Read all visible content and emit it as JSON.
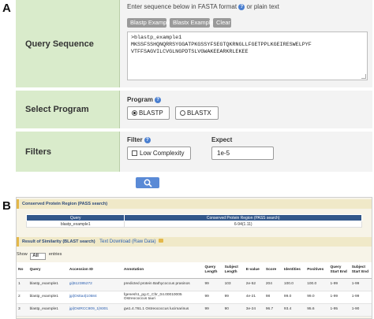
{
  "panel_labels": {
    "a": "A",
    "b": "B"
  },
  "colors": {
    "label_bg": "#d9ebcb",
    "accent_blue": "#5a8ad6",
    "table_header": "#32578a",
    "section_bar": "#e4b84a",
    "button_gray": "#9a9a9a"
  },
  "query": {
    "label": "Query Sequence",
    "hint": "Enter sequence below in FASTA format",
    "hint_suffix": "or plain text",
    "buttons": {
      "blastp_example": "Blastp Example",
      "blastx_example": "Blastx Example",
      "clear": "Clear"
    },
    "sequence_lines": [
      ">blastp_example1",
      "MKSSFSSHQNQRRSYGGATPKGSSYFSEGTQKRNGLLFGETPPLKGEIRESWELPYF",
      "VTFFSAGVILCVGLNGPDTSLVGWAKEEARKRLEKEE"
    ]
  },
  "program": {
    "label": "Select Program",
    "field_label": "Program",
    "options": [
      "BLASTP",
      "BLASTX"
    ],
    "selected": "BLASTP"
  },
  "filters": {
    "label": "Filters",
    "filter_label": "Filter",
    "low_complexity": "Low Complexity",
    "expect_label": "Expect",
    "expect_value": "1e-5"
  },
  "search": {
    "icon": "search-icon"
  },
  "results": {
    "conserved": {
      "title": "Conserved Protein Region (PASS search)",
      "columns": [
        "Query",
        "Conserved Protein Region (PASS search)"
      ],
      "rows": [
        [
          "blastp_example1",
          "6-94(1.11)"
        ]
      ]
    },
    "similarity": {
      "title": "Result of Similarity (BLAST search)",
      "download": "Text Download (Raw Data)"
    },
    "show": {
      "prefix": "Show",
      "value": "All",
      "suffix": "entries"
    },
    "table": {
      "columns": [
        "No",
        "Query",
        "Accession ID",
        "Annotation",
        "Query Length",
        "Subject Length",
        "E-value",
        "Score",
        "Identities",
        "Positives",
        "Query Start End",
        "Subject Start End"
      ],
      "rows": [
        [
          "1",
          "blastp_example1",
          "gi|612385272",
          "predicted protein Bathycoccus prasinos",
          "99",
          "103",
          "2e-52",
          "204",
          "100.0",
          "100.0",
          "1-99",
          "1-99"
        ],
        [
          "2",
          "blastp_example1",
          "jgi|Ostta4|10584",
          "fgenesh1_pg.C_Chr_04.00010005 Ostreococcus tauri",
          "99",
          "99",
          "4e-21",
          "98",
          "99.0",
          "99.0",
          "1-99",
          "1-99"
        ],
        [
          "3",
          "blastp_example1",
          "jgi|OstRCC809_1|9301",
          "gw1.4.761.1 Ostreococcus lucimarinus",
          "99",
          "90",
          "3e-24",
          "96.7",
          "93.4",
          "95.6",
          "1-95",
          "1-90"
        ]
      ]
    }
  }
}
